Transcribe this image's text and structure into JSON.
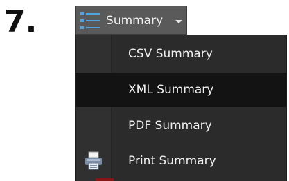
{
  "step": {
    "number": "7."
  },
  "summary_button": {
    "label": "Summary",
    "icon": "list-icon"
  },
  "menu": {
    "items": [
      {
        "label": "CSV Summary",
        "selected": false
      },
      {
        "label": "XML Summary",
        "selected": true
      },
      {
        "label": "PDF Summary",
        "selected": false
      },
      {
        "label": "Print Summary",
        "selected": false,
        "icon": "printer-icon"
      }
    ]
  },
  "colors": {
    "button_bg": "#5a5a5a",
    "menu_bg": "#2b2b2b",
    "selected_bg": "#131313",
    "icon_accent": "#4fa3e0",
    "text": "#f0f0f0"
  }
}
